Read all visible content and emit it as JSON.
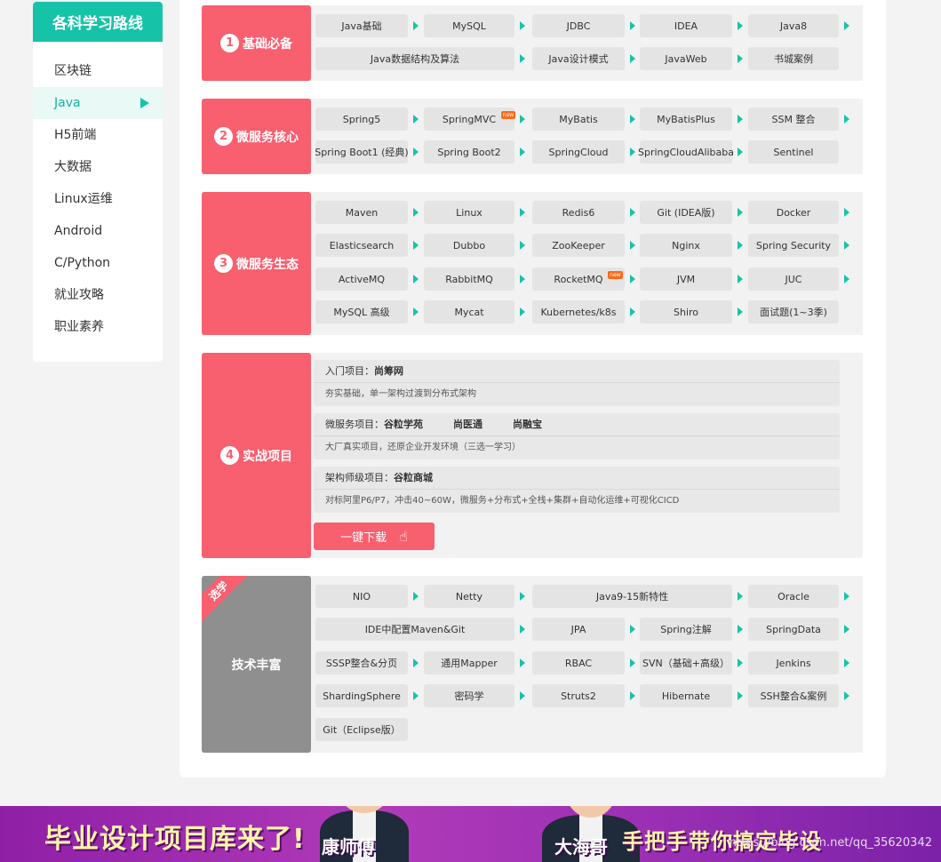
{
  "sidebar": {
    "title": "各科学习路线",
    "items": [
      "区块链",
      "Java",
      "H5前端",
      "大数据",
      "Linux运维",
      "Android",
      "C/Python",
      "就业攻略",
      "职业素养"
    ]
  },
  "sections": {
    "s1": {
      "num": "1",
      "title": "基础必备",
      "row1": [
        "Java基础",
        "MySQL",
        "JDBC",
        "IDEA",
        "Java8"
      ],
      "row2": [
        "Java数据结构及算法",
        "Java设计模式",
        "JavaWeb",
        "书城案例"
      ]
    },
    "s2": {
      "num": "2",
      "title": "微服务核心",
      "row1": [
        "Spring5",
        "SpringMVC",
        "MyBatis",
        "MyBatisPlus",
        "SSM 整合"
      ],
      "row2": [
        "Spring Boot1 (经典)",
        "Spring Boot2",
        "SpringCloud",
        "SpringCloudAlibaba",
        "Sentinel"
      ],
      "badge": "new"
    },
    "s3": {
      "num": "3",
      "title": "微服务生态",
      "row1": [
        "Maven",
        "Linux",
        "Redis6",
        "Git (IDEA版)",
        "Docker"
      ],
      "row2": [
        "Elasticsearch",
        "Dubbo",
        "ZooKeeper",
        "Nginx",
        "Spring Security"
      ],
      "row3": [
        "ActiveMQ",
        "RabbitMQ",
        "RocketMQ",
        "JVM",
        "JUC"
      ],
      "row4": [
        "MySQL 高级",
        "Mycat",
        "Kubernetes/k8s",
        "Shiro",
        "面试题(1~3季)"
      ],
      "badge": "new"
    },
    "s4": {
      "num": "4",
      "title": "实战项目",
      "p1": {
        "label": "入门项目：",
        "name": "尚筹网",
        "desc": "夯实基础，单一架构过渡到分布式架构"
      },
      "p2": {
        "label": "微服务项目：",
        "name": "谷粒学苑",
        "name2": "尚医通",
        "name3": "尚融宝",
        "desc": "大厂真实项目，还原企业开发环境（三选一学习）"
      },
      "p3": {
        "label": "架构师级项目：",
        "name": "谷粒商城",
        "desc": "对标阿里P6/P7，冲击40~60W，微服务+分布式+全栈+集群+自动化运维+可视化CICD"
      },
      "download": "一键下载"
    },
    "s5": {
      "ribbon": "选学",
      "title": "技术丰富",
      "row1": [
        "NIO",
        "Netty",
        "Java9-15新特性",
        "Oracle"
      ],
      "row2": [
        "IDE中配置Maven&Git",
        "JPA",
        "Spring注解",
        "SpringData"
      ],
      "row3": [
        "SSSP整合&分页",
        "通用Mapper",
        "RBAC",
        "SVN（基础+高级）",
        "Jenkins"
      ],
      "row4": [
        "ShardingSphere",
        "密码学",
        "Struts2",
        "Hibernate",
        "SSH整合&案例"
      ],
      "row5": [
        "Git（Eclipse版）"
      ]
    }
  },
  "banner": {
    "left_text": "毕业设计项目库来了!",
    "left_name": "康师傅",
    "right_name": "大海哥",
    "right_text": "手把手带你搞定毕设",
    "watermark": "https://blog.csdn.net/qq_35620342"
  },
  "colors": {
    "accent": "#17c3a8",
    "section": "#f85f6f",
    "optional": "#8f8f8f"
  }
}
